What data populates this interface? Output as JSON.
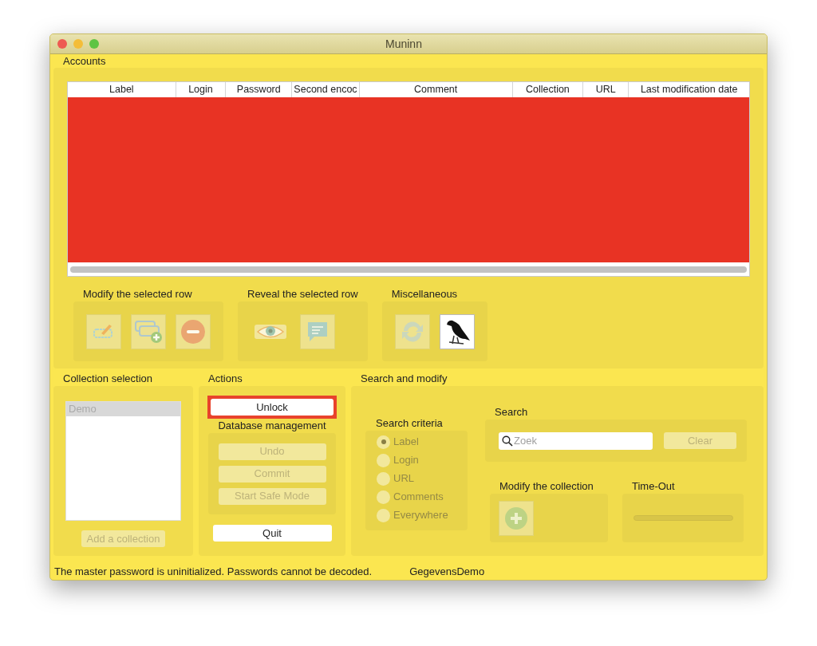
{
  "window": {
    "title": "Muninn"
  },
  "accounts": {
    "title": "Accounts",
    "columns": [
      "Label",
      "Login",
      "Password",
      "Second encoc",
      "Comment",
      "Collection",
      "URL",
      "Last modification date"
    ]
  },
  "row_groups": [
    {
      "title": "Modify the selected row",
      "buttons": [
        {
          "kind": "edit",
          "disabled": true
        },
        {
          "kind": "add",
          "disabled": true
        },
        {
          "kind": "remove",
          "disabled": true
        }
      ]
    },
    {
      "title": "Reveal the selected row",
      "buttons": [
        {
          "kind": "reveal",
          "disabled": true
        },
        {
          "kind": "comment",
          "disabled": true
        }
      ]
    },
    {
      "title": "Miscellaneous",
      "buttons": [
        {
          "kind": "refresh",
          "disabled": true
        },
        {
          "kind": "bird",
          "disabled": false
        }
      ]
    }
  ],
  "collection_selection": {
    "title": "Collection selection",
    "items": [
      {
        "label": "Demo",
        "selected": true,
        "disabled": true
      }
    ],
    "add_button": {
      "label": "Add a collection",
      "disabled": true
    }
  },
  "actions": {
    "title": "Actions",
    "unlock": {
      "label": "Unlock",
      "highlighted": true
    },
    "database_management": {
      "title": "Database management",
      "buttons": [
        {
          "label": "Undo",
          "disabled": true
        },
        {
          "label": "Commit",
          "disabled": true
        },
        {
          "label": "Start Safe Mode",
          "disabled": true
        }
      ]
    },
    "quit": {
      "label": "Quit"
    }
  },
  "search_and_modify": {
    "title": "Search and modify",
    "criteria": {
      "title": "Search criteria",
      "options": [
        {
          "label": "Label",
          "selected": true,
          "disabled": true
        },
        {
          "label": "Login",
          "selected": false,
          "disabled": true
        },
        {
          "label": "URL",
          "selected": false,
          "disabled": true
        },
        {
          "label": "Comments",
          "selected": false,
          "disabled": true
        },
        {
          "label": "Everywhere",
          "selected": false,
          "disabled": true
        }
      ]
    },
    "search": {
      "title": "Search",
      "placeholder": "Zoek",
      "clear": {
        "label": "Clear",
        "disabled": true
      }
    },
    "modify_collection": {
      "title": "Modify the collection",
      "button": {
        "kind": "add-circle",
        "disabled": true
      }
    },
    "time_out": {
      "title": "Time-Out",
      "level": 0
    }
  },
  "status_bar": {
    "message": "The master password is uninitialized. Passwords cannot be decoded.",
    "database": "GegevensDemo"
  }
}
